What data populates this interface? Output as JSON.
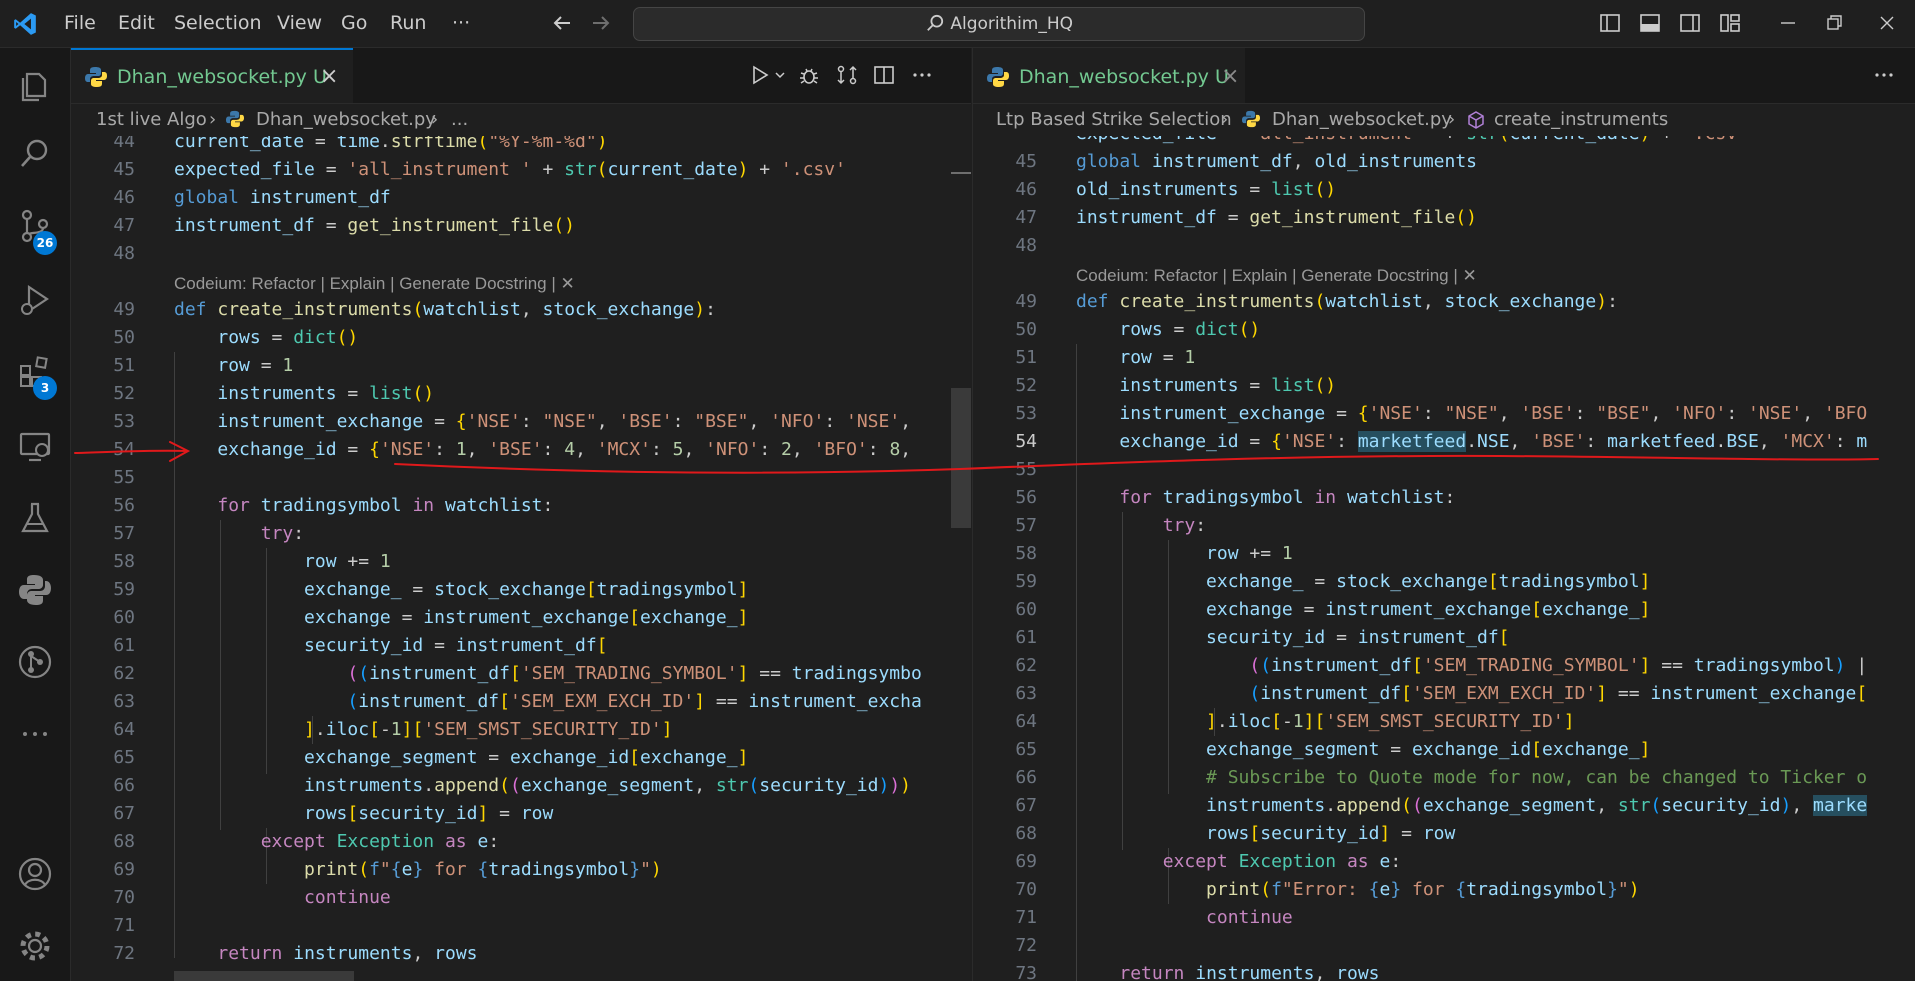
{
  "titlebar": {
    "menus": [
      "File",
      "Edit",
      "Selection",
      "View",
      "Go",
      "Run",
      "···"
    ],
    "search_text": "Algorithim_HQ"
  },
  "activitybar": {
    "source_control_badge": "26",
    "extensions_badge": "3"
  },
  "left": {
    "tab_label": "Dhan_websocket.py",
    "tab_status": "U",
    "breadcrumb": [
      "1st live Algo",
      "Dhan_websocket.py",
      "..."
    ],
    "codelens": "Codeium: Refactor | Explain | Generate Docstring | ✕",
    "line_numbers": [
      "44",
      "45",
      "46",
      "47",
      "48",
      "49",
      "50",
      "51",
      "52",
      "53",
      "54",
      "55",
      "56",
      "57",
      "58",
      "59",
      "60",
      "61",
      "62",
      "63",
      "64",
      "65",
      "66",
      "67",
      "68",
      "69",
      "70",
      "71",
      "72"
    ]
  },
  "right": {
    "tab_label": "Dhan_websocket.py",
    "tab_status": "U",
    "breadcrumb": [
      "Ltp Based Strike Selection",
      "Dhan_websocket.py",
      "create_instruments"
    ],
    "codelens": "Codeium: Refactor | Explain | Generate Docstring | ✕",
    "line_numbers": [
      "45",
      "46",
      "47",
      "48",
      "49",
      "50",
      "51",
      "52",
      "53",
      "54",
      "55",
      "56",
      "57",
      "58",
      "59",
      "60",
      "61",
      "62",
      "63",
      "64",
      "65",
      "66",
      "67",
      "68",
      "69",
      "70",
      "71",
      "72",
      "73"
    ]
  },
  "colors": {
    "accent": "#0078d4",
    "annotation": "#e0191b",
    "untracked": "#73c991"
  }
}
